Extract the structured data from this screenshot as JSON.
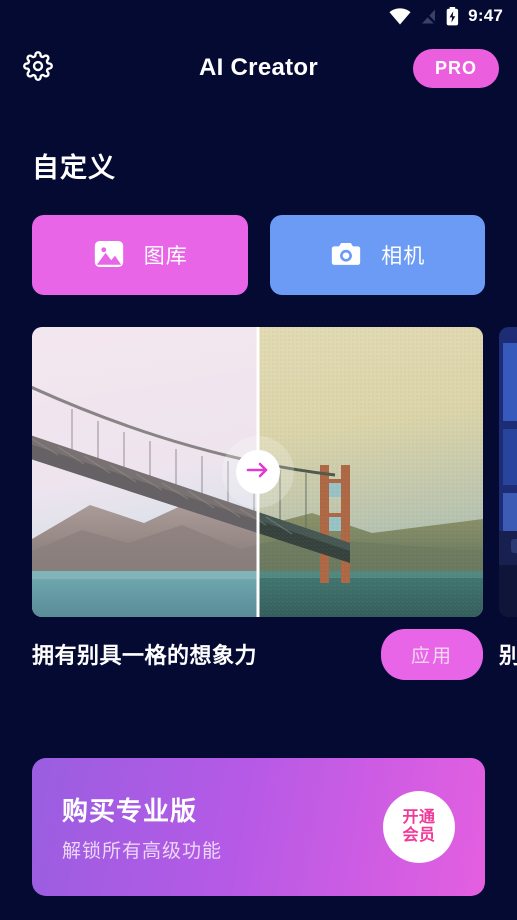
{
  "status_bar": {
    "time": "9:47",
    "icons": [
      "wifi-icon",
      "signal-off-icon",
      "battery-charging-icon"
    ]
  },
  "header": {
    "settings_icon": "gear-icon",
    "title": "AI Creator",
    "pro_label": "PRO"
  },
  "section": {
    "title": "自定义"
  },
  "source_buttons": [
    {
      "label": "图库",
      "icon": "image-icon",
      "color": "#e965e8"
    },
    {
      "label": "相机",
      "icon": "camera-icon",
      "color": "#6c9bf5"
    }
  ],
  "cards": [
    {
      "caption": "拥有别具一格的想象力",
      "apply_label": "应用",
      "handle_icon": "arrow-right-icon",
      "scene": "golden-gate-bridge"
    },
    {
      "caption": "别具",
      "scene": "neon-city-night"
    }
  ],
  "pro_banner": {
    "title": "购买专业版",
    "subtitle": "解锁所有高级功能",
    "cta_line1": "开通",
    "cta_line2": "会员"
  },
  "colors": {
    "background": "#050a33",
    "accent_pink": "#e965e8",
    "accent_blue": "#6c9bf5",
    "pro_pink": "#eb5fde",
    "cta_text": "#f0399a"
  }
}
